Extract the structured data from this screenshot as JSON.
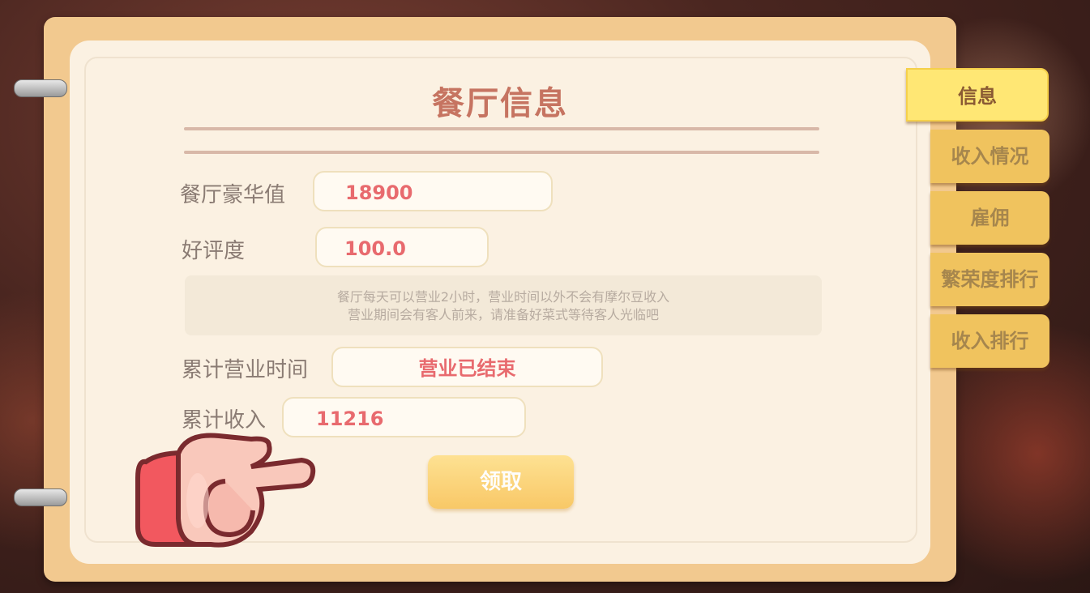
{
  "panel": {
    "title": "餐厅信息"
  },
  "fields": [
    {
      "label": "餐厅豪华值",
      "value": "18900"
    },
    {
      "label": "好评度",
      "value": "100.0"
    },
    {
      "label": "累计营业时间",
      "value": "营业已结束"
    },
    {
      "label": "累计收入",
      "value": "11216"
    }
  ],
  "notice": {
    "line1": "餐厅每天可以营业2小时，营业时间以外不会有摩尔豆收入",
    "line2": "营业期间会有客人前来，请准备好菜式等待客人光临吧"
  },
  "claim_button": {
    "label": "领取"
  },
  "tabs": [
    {
      "label": "信息",
      "active": true
    },
    {
      "label": "收入情况",
      "active": false
    },
    {
      "label": "雇佣",
      "active": false
    },
    {
      "label": "繁荣度排行",
      "active": false
    },
    {
      "label": "收入排行",
      "active": false
    }
  ],
  "colors": {
    "accent_text": "#e86a6e",
    "title": "#c67461",
    "tab": "#f0c35e",
    "tab_active": "#ffe774"
  },
  "icons": {
    "pointer": "pointing-hand-icon"
  }
}
